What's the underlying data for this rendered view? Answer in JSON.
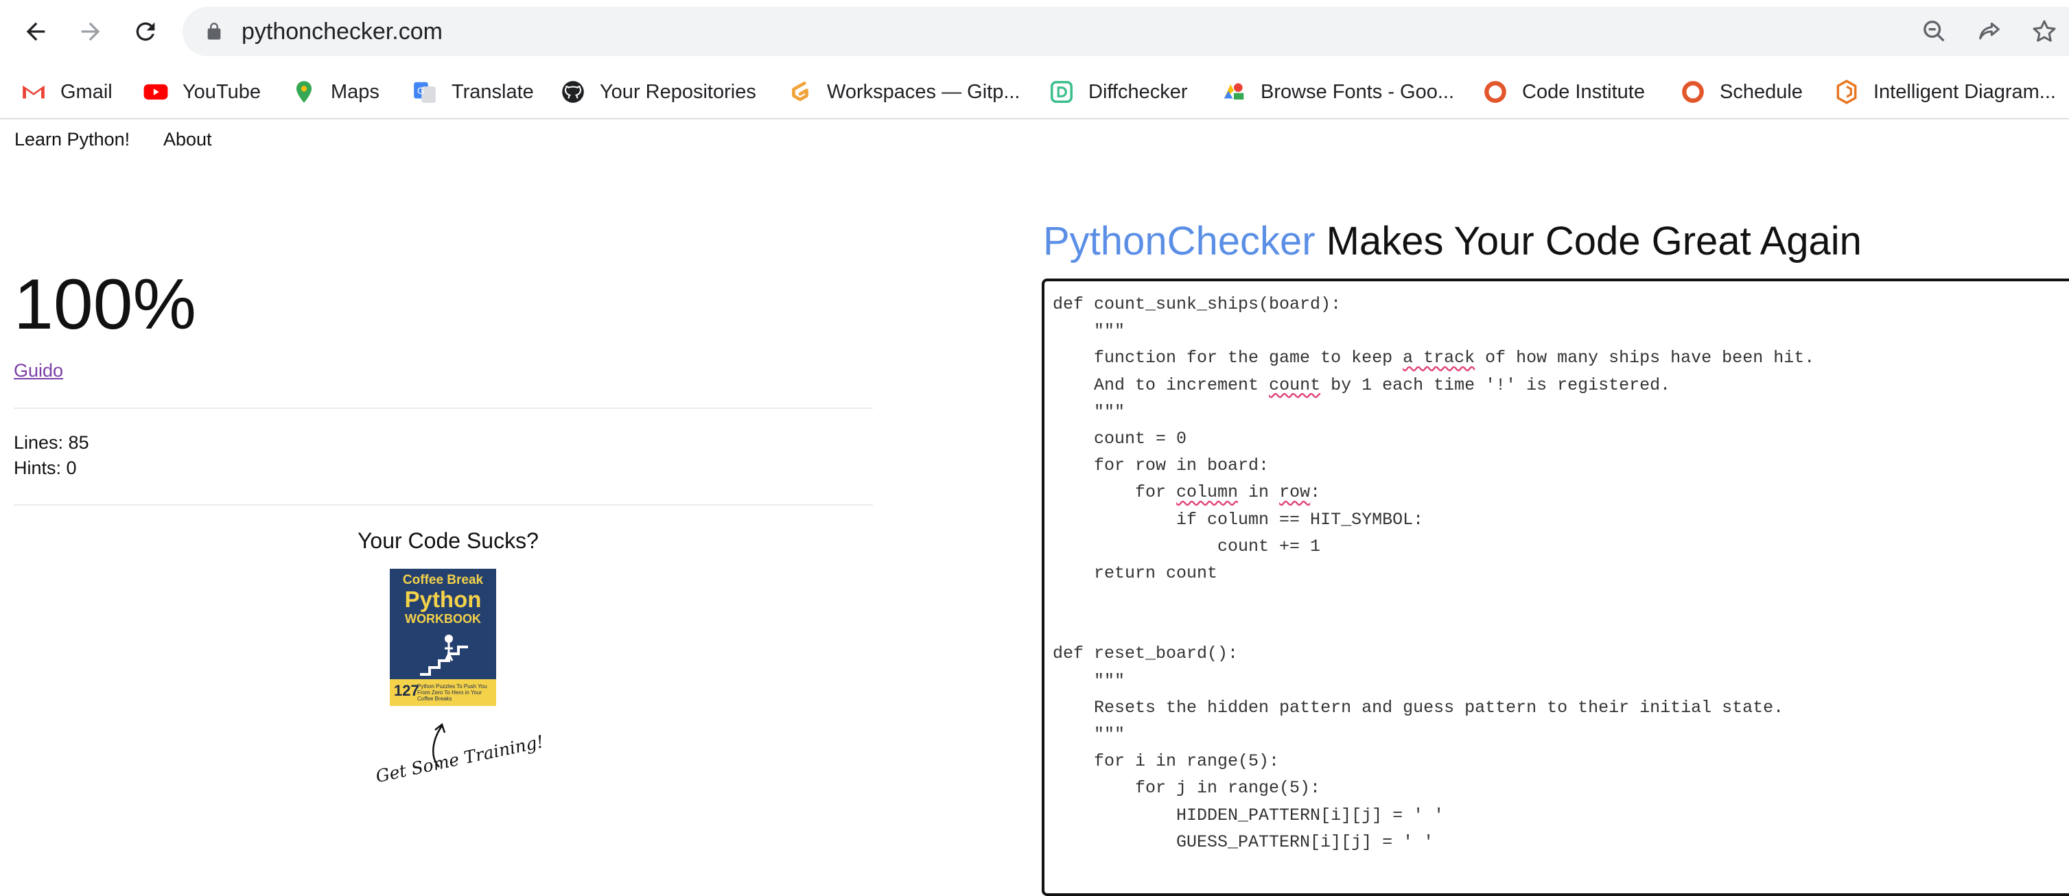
{
  "browser": {
    "url": "pythonchecker.com",
    "bookmarks": [
      {
        "label": "Gmail",
        "icon": "gmail-icon"
      },
      {
        "label": "YouTube",
        "icon": "youtube-icon"
      },
      {
        "label": "Maps",
        "icon": "maps-icon"
      },
      {
        "label": "Translate",
        "icon": "translate-icon"
      },
      {
        "label": "Your Repositories",
        "icon": "github-icon"
      },
      {
        "label": "Workspaces — Gitp...",
        "icon": "gitpod-icon"
      },
      {
        "label": "Diffchecker",
        "icon": "diffchecker-icon"
      },
      {
        "label": "Browse Fonts - Goo...",
        "icon": "google-fonts-icon"
      },
      {
        "label": "Code Institute",
        "icon": "code-institute-icon"
      },
      {
        "label": "Schedule",
        "icon": "schedule-icon"
      },
      {
        "label": "Intelligent Diagram...",
        "icon": "diagram-icon"
      }
    ]
  },
  "nav": {
    "learn": "Learn Python!",
    "about": "About"
  },
  "results": {
    "score": "100%",
    "author": "Guido",
    "lines": "Lines: 85",
    "hints": "Hints: 0"
  },
  "promo": {
    "heading": "Your Code Sucks?",
    "book_line1": "Coffee Break",
    "book_line2": "Python",
    "book_line3": "WORKBOOK",
    "book_number": "127",
    "book_subtitle": "Python Puzzles To Push You From Zero To Hero in Your Coffee Breaks",
    "caption": "Get Some Training!"
  },
  "headline": {
    "brand": "PythonChecker",
    "rest": " Makes Your Code Great Again"
  },
  "code": [
    "def count_sunk_ships(board):",
    "    \"\"\"",
    "    function for the game to keep a track of how many ships have been hit.",
    "    And to increment count by 1 each time '!' is registered.",
    "    \"\"\"",
    "    count = 0",
    "    for row in board:",
    "        for column in row:",
    "            if column == HIT_SYMBOL:",
    "                count += 1",
    "    return count",
    "",
    "",
    "def reset_board():",
    "    \"\"\"",
    "    Resets the hidden pattern and guess pattern to their initial state.",
    "    \"\"\"",
    "    for i in range(5):",
    "        for j in range(5):",
    "            HIDDEN_PATTERN[i][j] = ' '",
    "            GUESS_PATTERN[i][j] = ' '"
  ],
  "colors": {
    "brand": "#5b8fe6",
    "visited_link": "#7a3fa6",
    "spell_underline": "#e0457b"
  }
}
